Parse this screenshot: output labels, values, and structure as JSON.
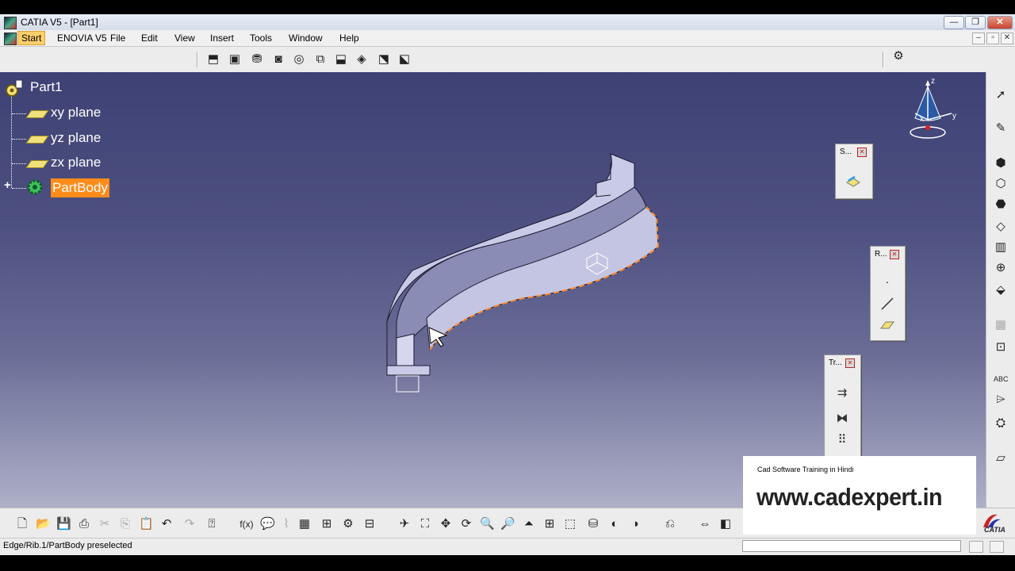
{
  "window": {
    "title": "CATIA V5 - [Part1]",
    "controls": {
      "minimize": "—",
      "restore": "❐",
      "close": "✕"
    }
  },
  "menubar": {
    "items": [
      "Start",
      "ENOVIA V5",
      "File",
      "Edit",
      "View",
      "Insert",
      "Tools",
      "Window",
      "Help"
    ],
    "active": "Start",
    "doc_controls": {
      "minimize": "–",
      "restore": "▫",
      "close": "✕"
    }
  },
  "tree": {
    "root": "Part1",
    "items": [
      {
        "label": "xy plane",
        "icon": "plane-icon"
      },
      {
        "label": "yz plane",
        "icon": "plane-icon"
      },
      {
        "label": "zx plane",
        "icon": "plane-icon"
      },
      {
        "label": "PartBody",
        "icon": "gear-body-icon",
        "selected": true
      }
    ],
    "selection_color": "#ff8c1a",
    "expand_symbol": "+"
  },
  "compass": {
    "axis_x": "x",
    "axis_y": "y",
    "axis_z": "z"
  },
  "floating_toolbars": [
    {
      "title": "S..."
    },
    {
      "title": "R..."
    },
    {
      "title": "Tr..."
    }
  ],
  "watermark": {
    "subtitle": "Cad Software Training in Hindi",
    "url": "www.cadexpert.in"
  },
  "status": {
    "message": "Edge/Rib.1/PartBody preselected",
    "command_input": ""
  },
  "brand": {
    "logo_text": "CATIA"
  },
  "colors": {
    "viewport_top": "#3e4174",
    "viewport_bottom": "#aeb0c8",
    "part_face": "#c9cae8",
    "part_side": "#8a8cb6",
    "highlight_edge": "#ff8a2a"
  }
}
